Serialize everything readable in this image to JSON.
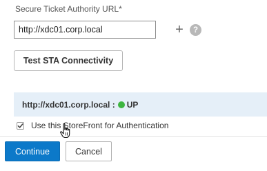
{
  "form": {
    "field_label": "Secure Ticket Authority URL*",
    "sta_url_value": "http://xdc01.corp.local",
    "add_glyph": "+",
    "help_glyph": "?",
    "test_button_label": "Test STA Connectivity"
  },
  "status": {
    "url_text": "http://xdc01.corp.local :",
    "state_text": "UP",
    "state_color": "#3db540"
  },
  "auth": {
    "checkbox_label": "Use this StoreFront for Authentication",
    "checked": true
  },
  "footer": {
    "continue_label": "Continue",
    "cancel_label": "Cancel"
  },
  "colors": {
    "primary": "#0c79c9",
    "status_bg": "#e5eff8"
  },
  "icons": {
    "add": "plus-icon",
    "help": "help-icon",
    "status": "status-dot-icon",
    "checkbox": "checkmark-icon",
    "cursor": "hand-pointer-icon"
  }
}
